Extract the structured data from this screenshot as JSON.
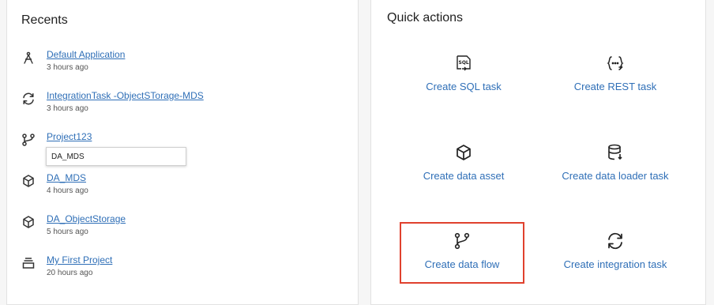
{
  "recents": {
    "title": "Recents",
    "items": [
      {
        "name": "Default Application",
        "time": "3 hours ago",
        "icon": "compass-icon"
      },
      {
        "name": "IntegrationTask -ObjectSTorage-MDS",
        "time": "3 hours ago",
        "icon": "refresh-icon"
      },
      {
        "name": "Project123",
        "time": "",
        "icon": "branch-icon"
      },
      {
        "name": "DA_MDS",
        "time": "4 hours ago",
        "icon": "cube-icon"
      },
      {
        "name": "DA_ObjectStorage",
        "time": "5 hours ago",
        "icon": "cube-icon"
      },
      {
        "name": "My First Project",
        "time": "20 hours ago",
        "icon": "stack-icon"
      }
    ],
    "tooltip": "DA_MDS"
  },
  "quick_actions": {
    "title": "Quick actions",
    "items": [
      {
        "label": "Create SQL task",
        "icon": "sql-icon"
      },
      {
        "label": "Create REST task",
        "icon": "rest-icon"
      },
      {
        "label": "Create data asset",
        "icon": "cube-icon"
      },
      {
        "label": "Create data loader task",
        "icon": "database-icon"
      },
      {
        "label": "Create data flow",
        "icon": "branch-icon",
        "highlighted": true
      },
      {
        "label": "Create integration task",
        "icon": "refresh-icon"
      }
    ]
  },
  "colors": {
    "link": "#2f6fb7",
    "highlight": "#e0412e"
  }
}
